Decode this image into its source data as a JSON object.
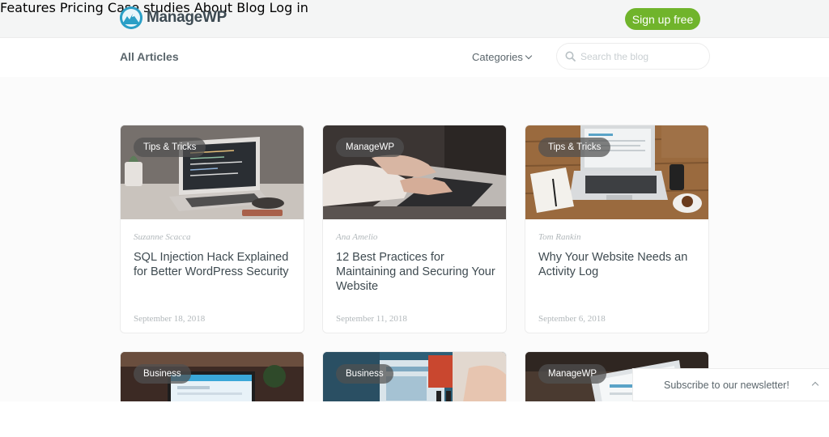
{
  "header": {
    "logo_text": "ManageWP",
    "nav": [
      {
        "label": "Features"
      },
      {
        "label": "Pricing"
      },
      {
        "label": "Case studies"
      },
      {
        "label": "About"
      },
      {
        "label": "Blog"
      },
      {
        "label": "Log in"
      }
    ],
    "signup_label": "Sign up free"
  },
  "subnav": {
    "all_articles": "All Articles",
    "categories": "Categories",
    "search_placeholder": "Search the blog"
  },
  "cards": [
    {
      "category": "Tips & Tricks",
      "author": "Suzanne Scacca",
      "title": "SQL Injection Hack Explained for Better WordPress Security",
      "date": "September 18, 2018"
    },
    {
      "category": "ManageWP",
      "author": "Ana Amelio",
      "title": "12 Best Practices for Maintaining and Securing Your Website",
      "date": "September 11, 2018"
    },
    {
      "category": "Tips & Tricks",
      "author": "Tom Rankin",
      "title": "Why Your Website Needs an Activity Log",
      "date": "September 6, 2018"
    },
    {
      "category": "Business"
    },
    {
      "category": "Business"
    },
    {
      "category": "ManageWP"
    }
  ],
  "newsletter": {
    "label": "Subscribe to our newsletter!"
  },
  "colors": {
    "brand_green": "#70b42b",
    "brand_blue": "#2b9fc6",
    "text_dark": "#3e4a50"
  }
}
